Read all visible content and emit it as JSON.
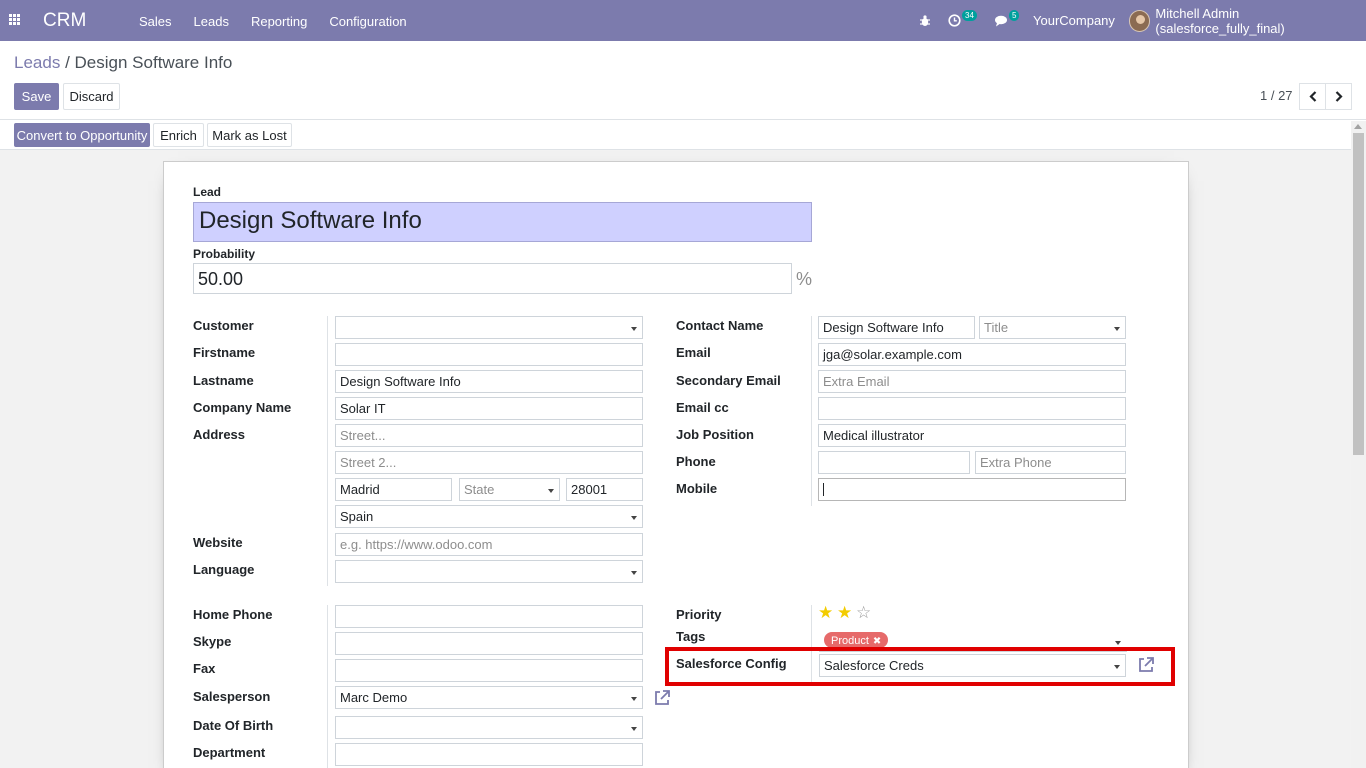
{
  "navbar": {
    "brand": "CRM",
    "menu": [
      "Sales",
      "Leads",
      "Reporting",
      "Configuration"
    ],
    "activity_count": "34",
    "message_count": "5",
    "company": "YourCompany",
    "user": "Mitchell Admin (salesforce_fully_final)"
  },
  "breadcrumb": {
    "parent": "Leads",
    "separator": "/",
    "current": "Design Software Info"
  },
  "buttons": {
    "save": "Save",
    "discard": "Discard",
    "convert": "Convert to Opportunity",
    "enrich": "Enrich",
    "mark_lost": "Mark as Lost"
  },
  "pager": {
    "value": "1 / 27"
  },
  "form": {
    "lead_label": "Lead",
    "lead_name": "Design Software Info",
    "probability_label": "Probability",
    "probability": "50.00",
    "percent": "%",
    "left": {
      "customer_label": "Customer",
      "customer": "",
      "firstname_label": "Firstname",
      "firstname": "",
      "lastname_label": "Lastname",
      "lastname": "Design Software Info",
      "company_label": "Company Name",
      "company": "Solar IT",
      "address_label": "Address",
      "street_placeholder": "Street...",
      "street2_placeholder": "Street 2...",
      "city": "Madrid",
      "state_placeholder": "State",
      "zip": "28001",
      "country": "Spain",
      "website_label": "Website",
      "website_placeholder": "e.g. https://www.odoo.com",
      "language_label": "Language",
      "language": ""
    },
    "right": {
      "contact_label": "Contact Name",
      "contact": "Design Software Info",
      "title_placeholder": "Title",
      "email_label": "Email",
      "email": "jga@solar.example.com",
      "secondary_email_label": "Secondary Email",
      "secondary_email_placeholder": "Extra Email",
      "email_cc_label": "Email cc",
      "email_cc": "",
      "job_label": "Job Position",
      "job": "Medical illustrator",
      "phone_label": "Phone",
      "phone": "",
      "extra_phone_placeholder": "Extra Phone",
      "mobile_label": "Mobile",
      "mobile": ""
    },
    "lower_left": {
      "home_phone_label": "Home Phone",
      "home_phone": "",
      "skype_label": "Skype",
      "skype": "",
      "fax_label": "Fax",
      "fax": "",
      "salesperson_label": "Salesperson",
      "salesperson": "Marc Demo",
      "dob_label": "Date Of Birth",
      "dob": "",
      "department_label": "Department",
      "department": ""
    },
    "lower_right": {
      "priority_label": "Priority",
      "priority_stars": 2,
      "priority_max": 3,
      "tags_label": "Tags",
      "tag": "Product",
      "tag_remove": "✖",
      "sf_config_label": "Salesforce Config",
      "sf_config": "Salesforce Creds"
    }
  },
  "colors": {
    "brand": "#7c7bad",
    "highlight": "#e00000",
    "tag": "#e66a6a",
    "star": "#f3cc00"
  }
}
